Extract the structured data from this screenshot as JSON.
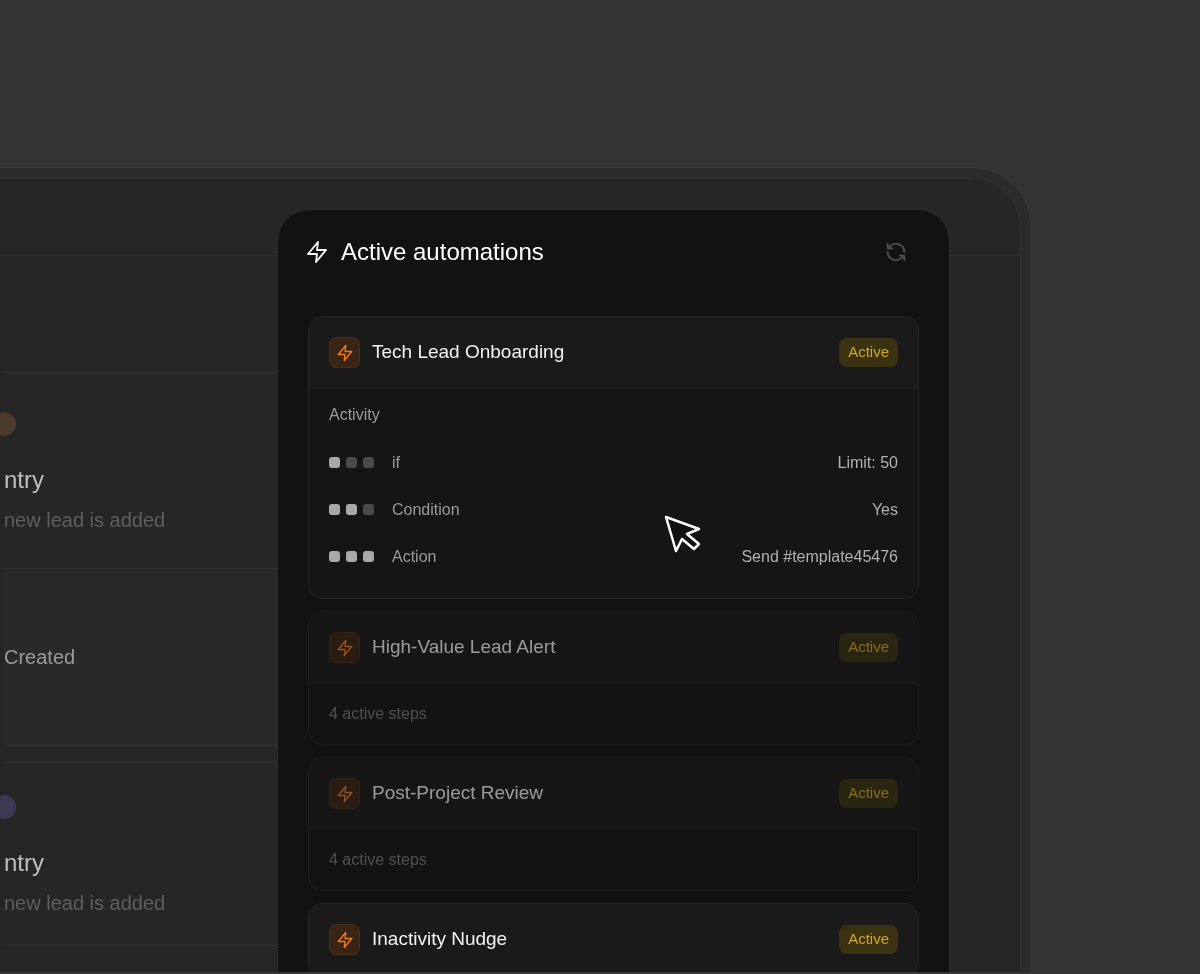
{
  "background_cards": [
    {
      "kind": "empty"
    },
    {
      "kind": "entry",
      "color": "#4a3a2a",
      "title": "ntry",
      "subtitle": "new lead is added"
    },
    {
      "kind": "label",
      "title": "Created"
    },
    {
      "kind": "entry",
      "color": "#3c3852",
      "title": "ntry",
      "subtitle": "new lead is added"
    }
  ],
  "panel": {
    "title": "Active automations",
    "automations": [
      {
        "name": "Tech Lead Onboarding",
        "status": "Active",
        "dimmed": false,
        "expanded": true,
        "section_label": "Activity",
        "steps": [
          {
            "label": "if",
            "value": "Limit: 50",
            "stars": 1
          },
          {
            "label": "Condition",
            "value": "Yes",
            "stars": 2
          },
          {
            "label": "Action",
            "value": "Send #template45476",
            "stars": 3
          }
        ]
      },
      {
        "name": "High-Value Lead Alert",
        "status": "Active",
        "dimmed": true,
        "expanded": false,
        "summary": "4 active steps"
      },
      {
        "name": "Post-Project Review",
        "status": "Active",
        "dimmed": true,
        "expanded": false,
        "summary": "4 active steps"
      },
      {
        "name": "Inactivity Nudge",
        "status": "Active",
        "dimmed": false,
        "expanded": false
      }
    ]
  }
}
